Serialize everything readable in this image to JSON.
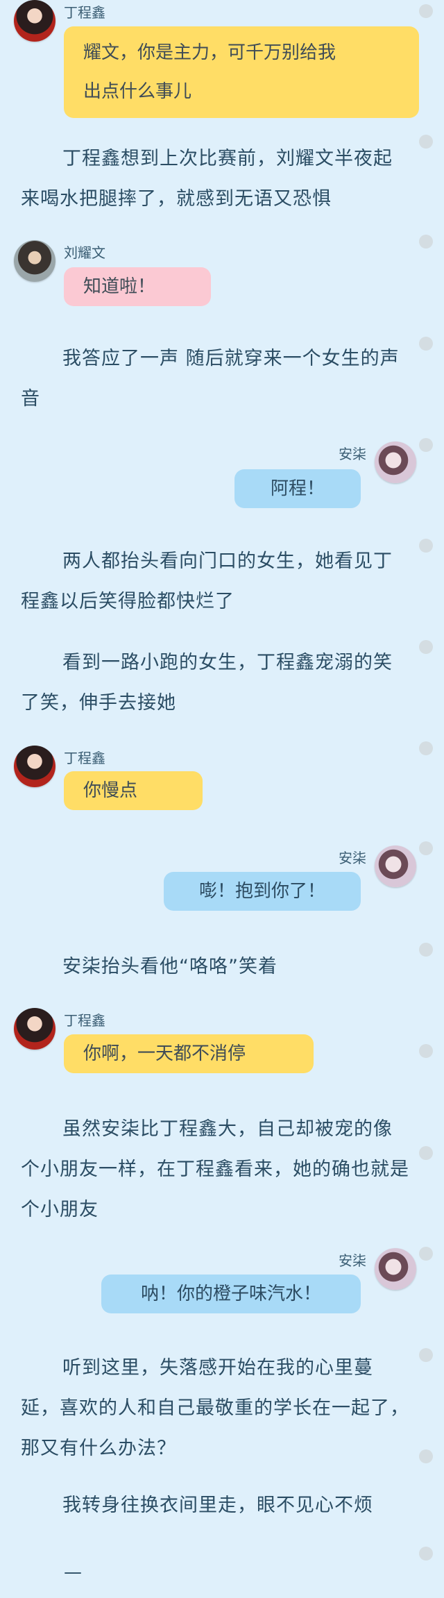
{
  "characters": {
    "ding": {
      "name": "丁程鑫",
      "avatar_icon": "avatar-ding-icon",
      "bubble_color": "#ffdd66"
    },
    "liu": {
      "name": "刘耀文",
      "avatar_icon": "avatar-liu-icon",
      "bubble_color": "#fbc9d3"
    },
    "an": {
      "name": "安柒",
      "avatar_icon": "avatar-an-icon",
      "bubble_color": "#a8daf7"
    }
  },
  "messages": [
    {
      "type": "chat",
      "side": "left",
      "speaker": "丁程鑫",
      "lines": [
        "耀文，你是主力，可千万别给我",
        "出点什么事儿"
      ]
    },
    {
      "type": "narration",
      "text": "丁程鑫想到上次比赛前，刘耀文半夜起来喝水把腿摔了，就感到无语又恐惧"
    },
    {
      "type": "chat",
      "side": "left",
      "speaker": "刘耀文",
      "lines": [
        "知道啦！"
      ]
    },
    {
      "type": "narration",
      "text": "我答应了一声 随后就穿来一个女生的声音"
    },
    {
      "type": "chat",
      "side": "right",
      "speaker": "安柒",
      "lines": [
        "阿程！"
      ]
    },
    {
      "type": "narration",
      "text": "两人都抬头看向门口的女生，她看见丁程鑫以后笑得脸都快烂了"
    },
    {
      "type": "narration",
      "text": "看到一路小跑的女生，丁程鑫宠溺的笑了笑，伸手去接她"
    },
    {
      "type": "chat",
      "side": "left",
      "speaker": "丁程鑫",
      "lines": [
        "你慢点"
      ]
    },
    {
      "type": "chat",
      "side": "right",
      "speaker": "安柒",
      "lines": [
        "嘭！抱到你了！"
      ]
    },
    {
      "type": "narration",
      "text": "安柒抬头看他“咯咯”笑着"
    },
    {
      "type": "chat",
      "side": "left",
      "speaker": "丁程鑫",
      "lines": [
        "你啊，一天都不消停"
      ]
    },
    {
      "type": "narration",
      "text": "虽然安柒比丁程鑫大，自己却被宠的像个小朋友一样，在丁程鑫看来，她的确也就是个小朋友"
    },
    {
      "type": "chat",
      "side": "right",
      "speaker": "安柒",
      "lines": [
        "呐！你的橙子味汽水！"
      ]
    },
    {
      "type": "narration",
      "text": "听到这里，失落感开始在我的心里蔓延，喜欢的人和自己最敬重的学长在一起了，那又有什么办法？"
    },
    {
      "type": "narration",
      "text": "我转身往换衣间里走，眼不见心不烦"
    }
  ],
  "ending": "—"
}
